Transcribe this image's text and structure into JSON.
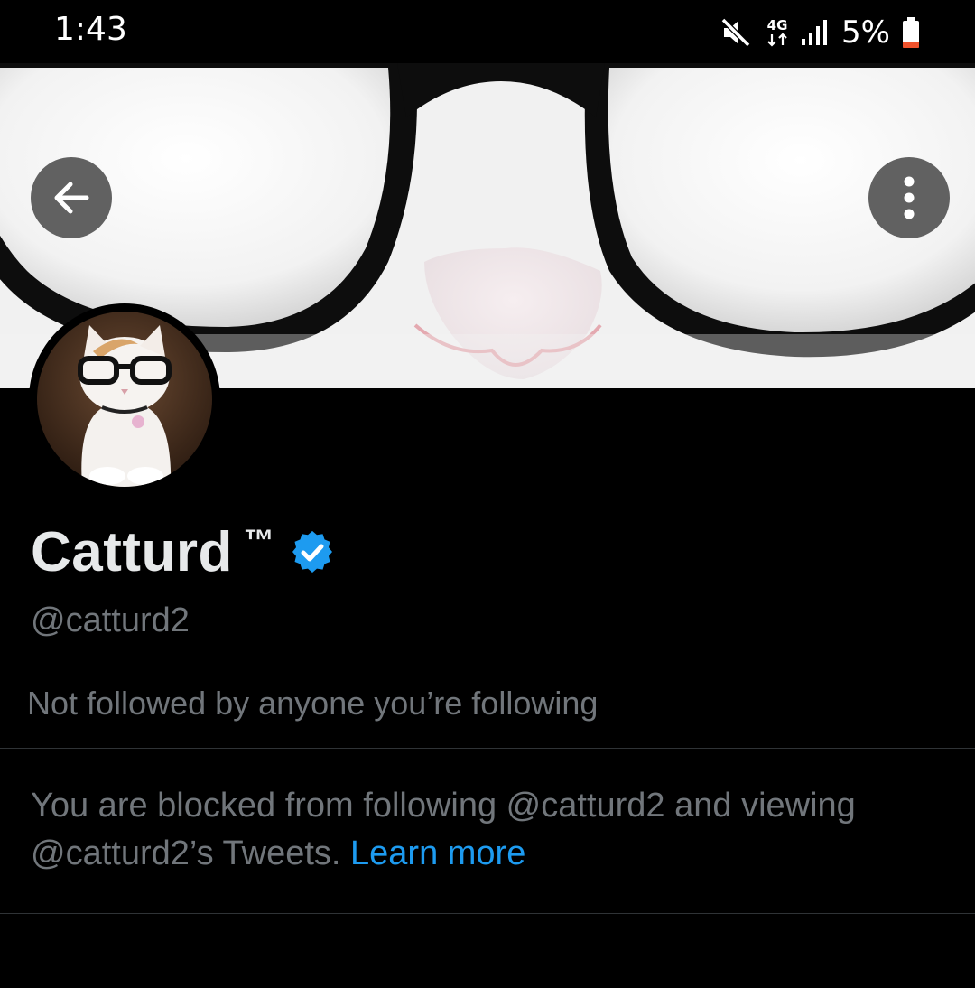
{
  "status_bar": {
    "time": "1:43",
    "network_type": "4G",
    "battery_percent": "5%",
    "icons": [
      "mute-icon",
      "data-arrows-icon",
      "signal-icon",
      "battery-low-icon"
    ]
  },
  "header": {
    "back_icon": "arrow-left-icon",
    "more_icon": "more-vertical-icon"
  },
  "profile": {
    "display_name": "Catturd",
    "trademark": "™",
    "verified": true,
    "verified_color": "#1d9bf0",
    "handle": "@catturd2",
    "followed_by_text": "Not followed by anyone you’re following"
  },
  "blocked_notice": {
    "message_part1": "You are blocked from following @catturd2 and viewing @catturd2’s Tweets.",
    "link_text": "Learn more",
    "link_color": "#1d9bf0"
  },
  "colors": {
    "background": "#000000",
    "primary_text": "#e7e9ea",
    "secondary_text": "#71767b",
    "divider": "#2f3336"
  }
}
